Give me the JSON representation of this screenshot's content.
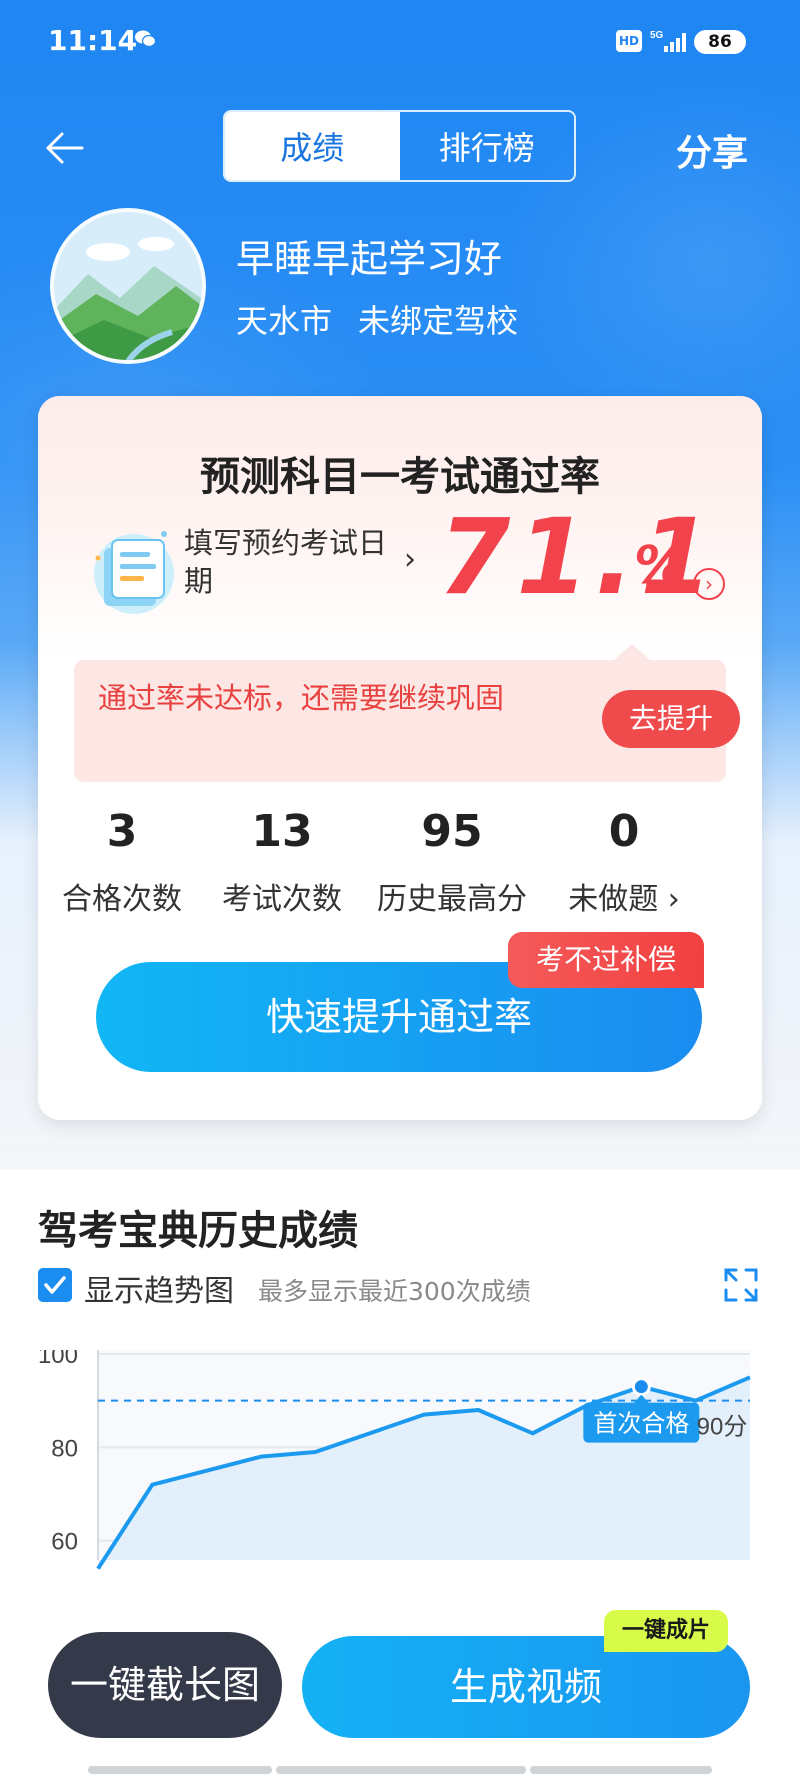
{
  "status_bar": {
    "time": "11:14",
    "hd": "HD",
    "battery": "86"
  },
  "nav": {
    "tabs": [
      {
        "label": "成绩"
      },
      {
        "label": "排行榜"
      }
    ],
    "share_label": "分享"
  },
  "profile": {
    "name": "早睡早起学习好",
    "city": "天水市",
    "school": "未绑定驾校"
  },
  "card": {
    "title": "预测科目一考试通过率",
    "date_label": "填写预约考试日期",
    "pass_rate": "71.1",
    "pass_rate_unit": "%",
    "warning_text": "通过率未达标，还需要继续巩固",
    "improve_button": "去提升",
    "stats": [
      {
        "value": "3",
        "label": "合格次数"
      },
      {
        "value": "13",
        "label": "考试次数"
      },
      {
        "value": "95",
        "label": "历史最高分"
      },
      {
        "value": "0",
        "label": "未做题"
      }
    ],
    "compensate_badge": "考不过补偿",
    "boost_button": "快速提升通过率"
  },
  "history": {
    "title": "驾考宝典历史成绩",
    "show_trend_label": "显示趋势图",
    "show_trend_checked": true,
    "show_trend_hint": "最多显示最近300次成绩"
  },
  "chart_data": {
    "type": "area",
    "y_ticks": [
      "100",
      "80",
      "60"
    ],
    "ylim": [
      55,
      100
    ],
    "values": [
      54,
      72,
      75,
      78,
      79,
      83,
      87,
      88,
      83,
      89,
      93,
      90,
      95
    ],
    "pass_line": {
      "value": 90,
      "label": "90分"
    },
    "first_pass": {
      "index": 10,
      "label": "首次合格"
    },
    "grid": true
  },
  "actions": {
    "long_screenshot": "一键截长图",
    "generate_video": "生成视频",
    "video_badge": "一键成片"
  },
  "colors": {
    "primary": "#1b8df0",
    "danger": "#f2424c",
    "dark_button": "#353a4a",
    "badge_lime": "#d8fb4a"
  }
}
